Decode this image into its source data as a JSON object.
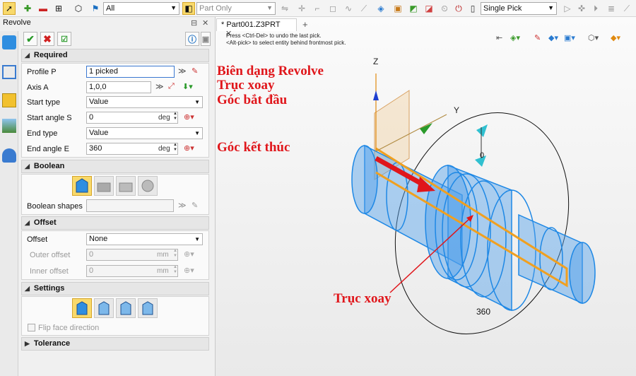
{
  "toolbar": {
    "filter_value": "All",
    "scope_value": "Part Only",
    "pick_value": "Single Pick"
  },
  "panel": {
    "title": "Revolve",
    "sections": {
      "required": "Required",
      "boolean": "Boolean",
      "offset": "Offset",
      "settings": "Settings",
      "tolerance": "Tolerance"
    },
    "required": {
      "profile_label": "Profile P",
      "profile_value": "1 picked",
      "axis_label": "Axis A",
      "axis_value": "1,0,0",
      "start_type_label": "Start type",
      "start_type_value": "Value",
      "start_angle_label": "Start angle S",
      "start_angle_value": "0",
      "start_angle_unit": "deg",
      "end_type_label": "End type",
      "end_type_value": "Value",
      "end_angle_label": "End angle E",
      "end_angle_value": "360",
      "end_angle_unit": "deg"
    },
    "boolean": {
      "shapes_label": "Boolean shapes",
      "shapes_value": ""
    },
    "offset": {
      "offset_label": "Offset",
      "offset_value": "None",
      "outer_label": "Outer offset",
      "outer_value": "0",
      "outer_unit": "mm",
      "inner_label": "Inner offset",
      "inner_value": "0",
      "inner_unit": "mm"
    },
    "settings": {
      "flip_label": "Flip face direction"
    }
  },
  "viewport": {
    "tab_label": "* Part001.Z3PRT",
    "hint_1": "Press <Ctrl-Del> to undo the last pick.",
    "hint_2": "<Alt-pick> to select entity behind frontmost pick.",
    "axis_z": "Z",
    "axis_y": "Y",
    "angle_start": "0",
    "angle_end": "360"
  },
  "annotations": {
    "profile": "Biên dạng Revolve",
    "axis": "Trục xoay",
    "start_angle": "Góc bắt đầu",
    "end_angle": "Góc kết thúc",
    "axis_arrow": "Trục xoay"
  },
  "colors": {
    "annotation_red": "#e0161b",
    "part_blue": "#2f8ee0",
    "profile_orange": "#f0a020",
    "selected_yellow": "#f8d96b"
  }
}
